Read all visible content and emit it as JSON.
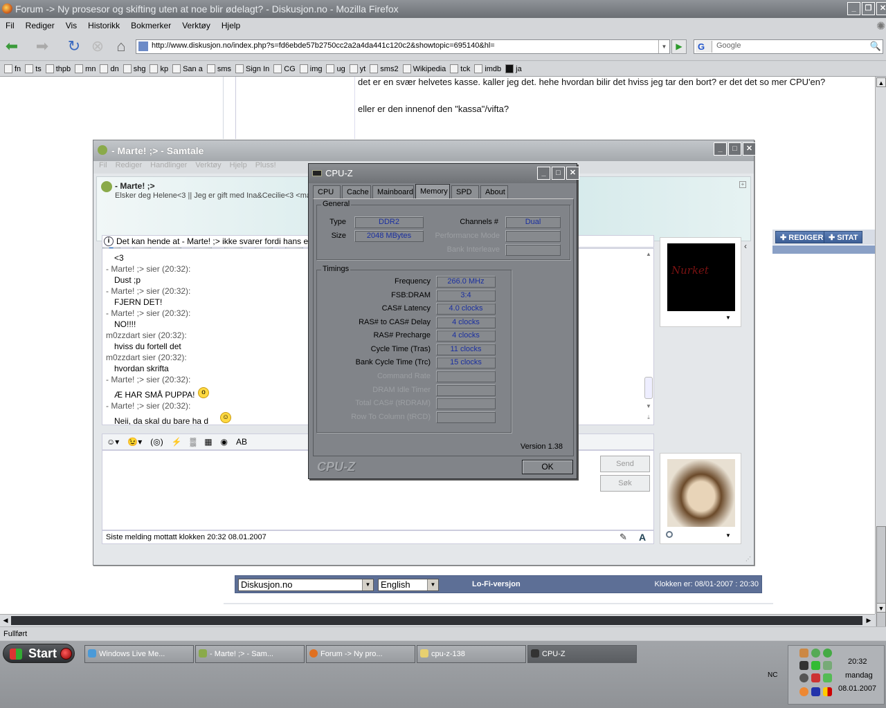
{
  "firefox": {
    "title": "Forum -> Ny prosesor og skifting uten at noe blir ødelagt? - Diskusjon.no - Mozilla Firefox",
    "menu": [
      "Fil",
      "Rediger",
      "Vis",
      "Historikk",
      "Bokmerker",
      "Verktøy",
      "Hjelp"
    ],
    "url": "http://www.diskusjon.no/index.php?s=fd6ebde57b2750cc2a2a4da441c120c2&showtopic=695140&hl=",
    "search_placeholder": "Google",
    "bookmarks": [
      "fn",
      "ts",
      "thpb",
      "mn",
      "dn",
      "shg",
      "kp",
      "San a",
      "sms",
      "Sign In",
      "CG",
      "img",
      "ug",
      "yt",
      "sms2",
      "Wikipedia",
      "tck",
      "imdb",
      "ja"
    ],
    "status": "Fullført"
  },
  "page": {
    "post_line1": "det er en svær helvetes kasse. kaller jeg det. hehe hvordan bilir det hviss jeg tar den bort? er det det so mer CPU'en?",
    "post_line2": "eller er den innenof den \"kassa\"/vifta?",
    "btn_edit": "REDIGER",
    "btn_quote": "SITAT",
    "footer_select1": "Diskusjon.no",
    "footer_select2": "English",
    "lofi": "Lo-Fi-versjon",
    "clock": "Klokken er: 08/01-2007 : 20:30"
  },
  "messenger": {
    "title": "- Marte! ;> - Samtale",
    "menu": [
      "Fil",
      "Rediger",
      "Handlinger",
      "Verktøy",
      "Hjelp",
      "Pluss!"
    ],
    "contact_name": "- Marte! ;>",
    "contact_message": "Elsker deg Helene<3 || Jeg er gift med Ina&Cecilie<3 <ma",
    "info": "Det kan hende at - Marte! ;> ikke svarer fordi hans eller h",
    "conversation": [
      {
        "kind": "msg",
        "text": "<3"
      },
      {
        "kind": "hdr",
        "text": "- Marte! ;> sier (20:32):"
      },
      {
        "kind": "msg",
        "text": "Dust ;p"
      },
      {
        "kind": "hdr",
        "text": "- Marte! ;> sier (20:32):"
      },
      {
        "kind": "msg",
        "text": "FJERN DET!"
      },
      {
        "kind": "hdr",
        "text": "- Marte! ;> sier (20:32):"
      },
      {
        "kind": "msg",
        "text": "NO!!!!"
      },
      {
        "kind": "hdr",
        "text": "m0zzdart sier (20:32):"
      },
      {
        "kind": "msg",
        "text": "hviss du fortell det"
      },
      {
        "kind": "hdr",
        "text": "m0zzdart sier (20:32):"
      },
      {
        "kind": "msg",
        "text": "hvordan skrifta"
      },
      {
        "kind": "hdr",
        "text": "- Marte! ;> sier (20:32):"
      },
      {
        "kind": "msg",
        "text": "Æ HAR SMÅ PUPPA!"
      },
      {
        "kind": "hdr",
        "text": "- Marte! ;> sier (20:32):"
      },
      {
        "kind": "msg",
        "text": "Neii, da skal du bare ha d"
      }
    ],
    "send_label": "Send",
    "search_label": "Søk",
    "status": "Siste melding mottatt klokken 20:32 08.01.2007",
    "avatar_text": "Nurket"
  },
  "cpuz": {
    "title": "CPU-Z",
    "tabs": [
      "CPU",
      "Cache",
      "Mainboard",
      "Memory",
      "SPD",
      "About"
    ],
    "active_tab": "Memory",
    "general_label": "General",
    "type_label": "Type",
    "type": "DDR2",
    "size_label": "Size",
    "size": "2048 MBytes",
    "channels_label": "Channels #",
    "channels": "Dual",
    "perf_mode_label": "Performance Mode",
    "bank_interleave_label": "Bank Interleave",
    "timings_label": "Timings",
    "timings": [
      {
        "label": "Frequency",
        "value": "266.0 MHz"
      },
      {
        "label": "FSB:DRAM",
        "value": "3:4"
      },
      {
        "label": "CAS# Latency",
        "value": "4.0 clocks"
      },
      {
        "label": "RAS# to CAS# Delay",
        "value": "4 clocks"
      },
      {
        "label": "RAS# Precharge",
        "value": "4 clocks"
      },
      {
        "label": "Cycle Time (Tras)",
        "value": "11 clocks"
      },
      {
        "label": "Bank Cycle Time (Trc)",
        "value": "15 clocks"
      }
    ],
    "disabled_timings": [
      "Command Rate",
      "DRAM Idle Timer",
      "Total CAS# (tRDRAM)",
      "Row To Column (tRCD)"
    ],
    "version": "Version 1.38",
    "logo": "CPU-Z",
    "ok_label": "OK"
  },
  "taskbar": {
    "start": "Start",
    "tasks": [
      "Windows Live Me...",
      "- Marte! ;> - Sam...",
      "Forum -> Ny pro...",
      "cpu-z-138",
      "CPU-Z"
    ],
    "nc": "NC",
    "time": "20:32",
    "day": "mandag",
    "date": "08.01.2007"
  }
}
